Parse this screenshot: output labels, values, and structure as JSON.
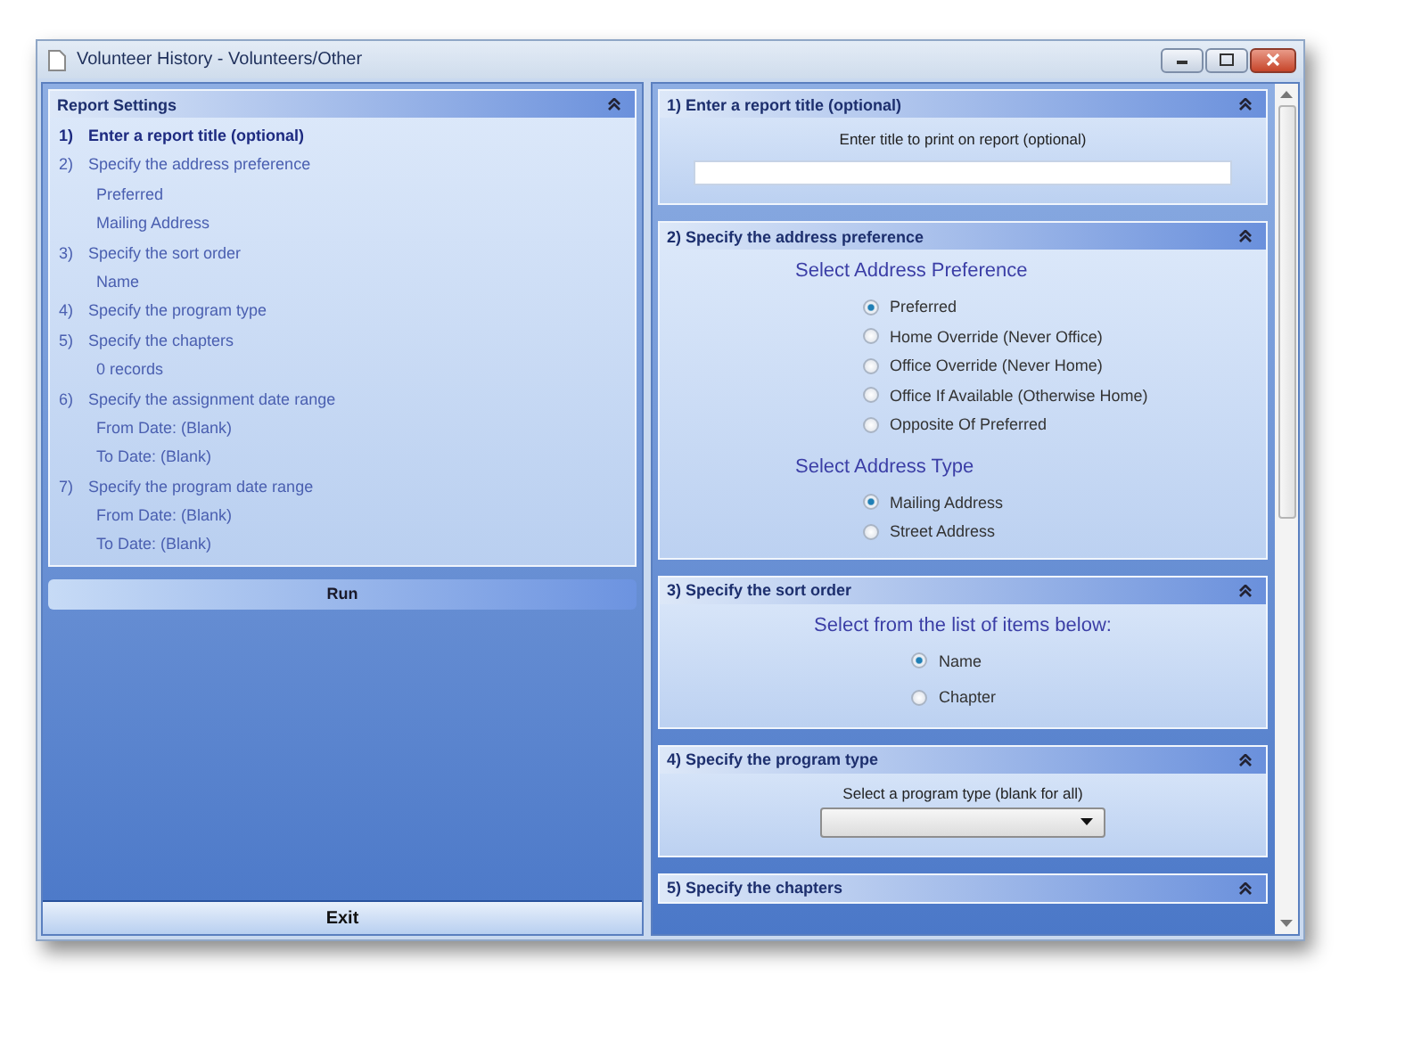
{
  "window": {
    "title": "Volunteer History - Volunteers/Other"
  },
  "summary": {
    "title": "Report Settings",
    "items": [
      {
        "kind": "step",
        "number": "1)",
        "text": "Enter a report title (optional)",
        "selected": true
      },
      {
        "kind": "step",
        "number": "2)",
        "text": "Specify the address preference",
        "selected": false
      },
      {
        "kind": "detail",
        "text": "Preferred",
        "selected": false
      },
      {
        "kind": "detail",
        "text": "Mailing Address",
        "selected": false
      },
      {
        "kind": "step",
        "number": "3)",
        "text": "Specify the sort order",
        "selected": false
      },
      {
        "kind": "detail",
        "text": "Name",
        "selected": false
      },
      {
        "kind": "step",
        "number": "4)",
        "text": "Specify the program type",
        "selected": false
      },
      {
        "kind": "step",
        "number": "5)",
        "text": "Specify the chapters",
        "selected": false
      },
      {
        "kind": "detail",
        "text": "0 records",
        "selected": false
      },
      {
        "kind": "step",
        "number": "6)",
        "text": "Specify the assignment date range",
        "selected": false
      },
      {
        "kind": "detail",
        "text": "From Date:  (Blank)",
        "selected": false
      },
      {
        "kind": "detail",
        "text": "To Date:  (Blank)",
        "selected": false
      },
      {
        "kind": "step",
        "number": "7)",
        "text": "Specify the program date range",
        "selected": false
      },
      {
        "kind": "detail",
        "text": "From Date:  (Blank)",
        "selected": false
      },
      {
        "kind": "detail",
        "text": "To Date:  (Blank)",
        "selected": false
      }
    ]
  },
  "run_button": "Run",
  "exit_button": "Exit",
  "sections": [
    {
      "number": "1)",
      "title": "Enter a report title (optional)",
      "kind": "text_input",
      "label": "Enter title to print on report (optional)"
    },
    {
      "number": "2)",
      "title": "Specify the address preference",
      "kind": "radios",
      "groups": [
        {
          "heading": "Select Address Preference",
          "options": [
            {
              "label": "Preferred",
              "selected": true
            },
            {
              "label": "Home Override (Never Office)",
              "selected": false
            },
            {
              "label": "Office Override (Never Home)",
              "selected": false
            },
            {
              "label": "Office If Available (Otherwise Home)",
              "selected": false
            },
            {
              "label": "Opposite Of Preferred",
              "selected": false
            }
          ]
        },
        {
          "heading": "Select Address Type",
          "options": [
            {
              "label": "Mailing Address",
              "selected": true
            },
            {
              "label": "Street Address",
              "selected": false
            }
          ]
        }
      ]
    },
    {
      "number": "3)",
      "title": "Specify the sort order",
      "kind": "radios",
      "groups": [
        {
          "heading": "Select from the list of items below:",
          "options": [
            {
              "label": "Name",
              "selected": true
            },
            {
              "label": "Chapter",
              "selected": false
            }
          ]
        }
      ]
    },
    {
      "number": "4)",
      "title": "Specify the program type",
      "kind": "dropdown",
      "label": "Select a program type (blank for all)"
    },
    {
      "number": "5)",
      "title": "Specify the chapters",
      "kind": "collapsed"
    }
  ]
}
